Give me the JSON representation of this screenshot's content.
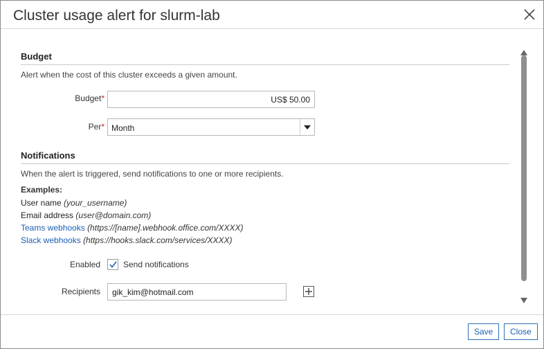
{
  "dialog": {
    "title": "Cluster usage alert for slurm-lab"
  },
  "budget_section": {
    "title": "Budget",
    "description": "Alert when the cost of this cluster exceeds a given amount.",
    "budget_label": "Budget",
    "budget_value": "US$ 50.00",
    "per_label": "Per",
    "per_value": "Month",
    "required_marker": "*"
  },
  "notifications_section": {
    "title": "Notifications",
    "description": "When the alert is triggered, send notifications to one or more recipients.",
    "examples_label": "Examples:",
    "examples": [
      {
        "label": "User name",
        "hint": "(your_username)",
        "is_link": false
      },
      {
        "label": "Email address",
        "hint": "(user@domain.com)",
        "is_link": false
      },
      {
        "label": "Teams webhooks",
        "hint": "(https://[name].webhook.office.com/XXXX)",
        "is_link": true
      },
      {
        "label": "Slack webhooks",
        "hint": "(https://hooks.slack.com/services/XXXX)",
        "is_link": true
      }
    ],
    "enabled_label": "Enabled",
    "enabled_checked": true,
    "send_notifications_label": "Send notifications",
    "recipients_label": "Recipients",
    "recipients_value": "gik_kim@hotmail.com"
  },
  "footer": {
    "save_label": "Save",
    "close_label": "Close"
  },
  "icons": {
    "close": "close-icon",
    "dropdown": "chevron-down-icon",
    "check": "check-icon",
    "add": "plus-icon"
  },
  "colors": {
    "link": "#1a5fb4",
    "required": "#c41e1e",
    "button_border": "#2f6fb4"
  }
}
